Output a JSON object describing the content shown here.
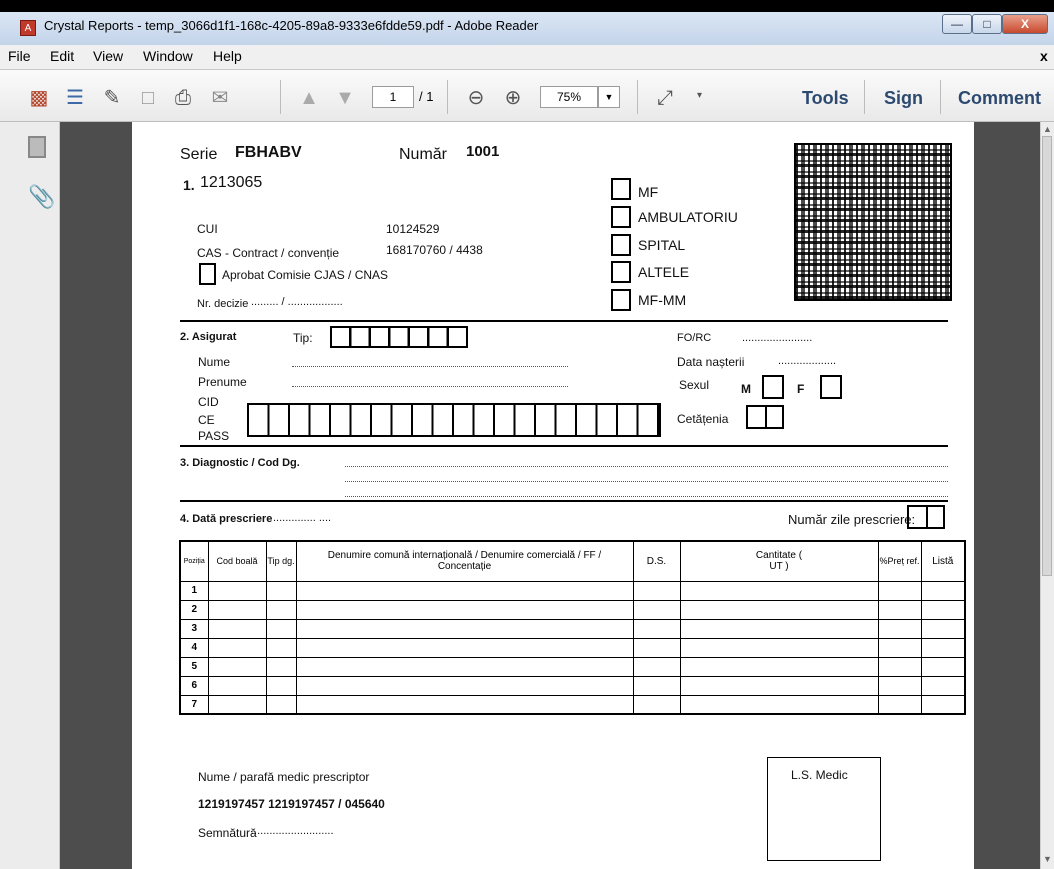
{
  "window": {
    "title": "Crystal Reports - temp_3066d1f1-168c-4205-89a8-9333e6fdde59.pdf - Adobe Reader",
    "minimize": "—",
    "restore": "□",
    "close": "X"
  },
  "menu": [
    "File",
    "Edit",
    "View",
    "Window",
    "Help"
  ],
  "menu_close": "x",
  "toolbar": {
    "page_current": "1",
    "page_total": "/ 1",
    "zoom": "75%",
    "tools": "Tools",
    "sign": "Sign",
    "comment": "Comment"
  },
  "form": {
    "serie_label": "Serie",
    "serie_value": "FBHABV",
    "numar_label": "Număr",
    "numar_value": "1001",
    "s1_num": "1.",
    "s1_code": "1213065",
    "cui_label": "CUI",
    "cui_value": "10124529",
    "cas_label": "CAS - Contract / convenție",
    "cas_value": "168170760 / 4438",
    "aprobat": "Aprobat Comisie CJAS / CNAS",
    "nr_decizie": "Nr. decizie",
    "nr_decizie_dots": "......... / ..................",
    "types": [
      "MF",
      "AMBULATORIU",
      "SPITAL",
      "ALTELE",
      "MF-MM"
    ],
    "asigurat": "2. Asigurat",
    "tip": "Tip:",
    "nume": "Nume",
    "prenume": "Prenume",
    "cid": "CID",
    "ce": "CE",
    "pass": "PASS",
    "forc": "FO/RC",
    "forc_dots": ".......................",
    "data_nasterii": "Data nașterii",
    "data_nasterii_dots": "...................",
    "sexul": "Sexul",
    "m": "M",
    "f": "F",
    "cetatenia": "Cetățenia",
    "diagnostic": "3. Diagnostic / Cod Dg.",
    "data_prescriere": "4. Dată prescriere",
    "data_prescriere_dots": ".............. ....",
    "numar_zile": "Număr zile prescriere:",
    "table_headers": {
      "pozitia": "Poziția",
      "cod_boala": "Cod boală",
      "tip_dg": "Tip dg.",
      "denumire": "Denumire comună internațională / Denumire comercială / FF / Concentație",
      "ds": "D.S.",
      "cantitate": "Cantitate ( UT )",
      "pret": "%Preț ref.",
      "lista": "Listă"
    },
    "rows": [
      "1",
      "2",
      "3",
      "4",
      "5",
      "6",
      "7"
    ],
    "medic_label": "Nume / parafă medic prescriptor",
    "medic_value": "1219197457 1219197457 / 045640",
    "semnatura": "Semnătură",
    "semnatura_dots": "...........................",
    "ls_medic": "L.S. Medic"
  }
}
